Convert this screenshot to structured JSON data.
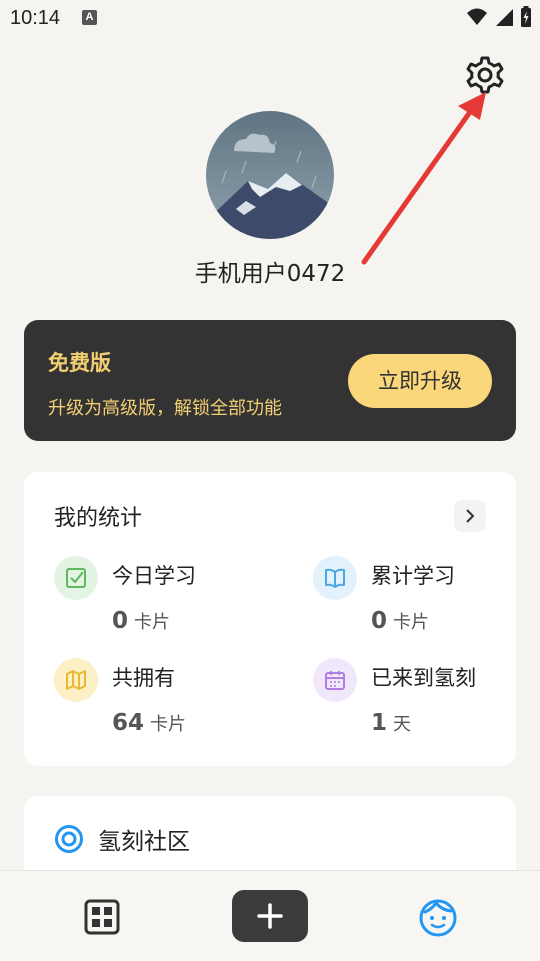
{
  "status_bar": {
    "time": "10:14",
    "notification_letter": "A"
  },
  "profile": {
    "username": "手机用户0472"
  },
  "premium": {
    "title": "免费版",
    "subtitle": "升级为高级版，解锁全部功能",
    "upgrade_label": "立即升级"
  },
  "stats": {
    "title": "我的统计",
    "items": [
      {
        "label": "今日学习",
        "value": "0",
        "unit": "卡片",
        "icon": "check-square-icon",
        "color": "#5cb85c"
      },
      {
        "label": "累计学习",
        "value": "0",
        "unit": "卡片",
        "icon": "book-icon",
        "color": "#4aa8e0"
      },
      {
        "label": "共拥有",
        "value": "64",
        "unit": "卡片",
        "icon": "cards-icon",
        "color": "#e8b830"
      },
      {
        "label": "已来到氢刻",
        "value": "1",
        "unit": "天",
        "icon": "calendar-icon",
        "color": "#b07ee0"
      }
    ]
  },
  "community": {
    "title": "氢刻社区"
  },
  "colors": {
    "accent": "#fad77a",
    "dark_card": "#333333",
    "annotation_arrow": "#e53935",
    "nav_active": "#2196f3"
  }
}
